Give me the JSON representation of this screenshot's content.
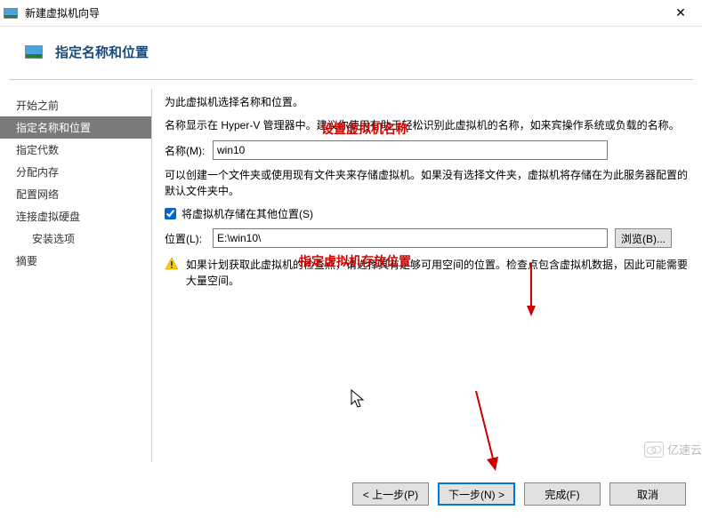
{
  "titlebar": {
    "title": "新建虚拟机向导",
    "close": "✕"
  },
  "header": {
    "title": "指定名称和位置"
  },
  "sidebar": {
    "items": [
      {
        "label": "开始之前"
      },
      {
        "label": "指定名称和位置"
      },
      {
        "label": "指定代数"
      },
      {
        "label": "分配内存"
      },
      {
        "label": "配置网络"
      },
      {
        "label": "连接虚拟硬盘"
      },
      {
        "label": "安装选项"
      },
      {
        "label": "摘要"
      }
    ]
  },
  "content": {
    "intro1": "为此虚拟机选择名称和位置。",
    "intro2": "名称显示在 Hyper-V 管理器中。建议你使用有助于轻松识别此虚拟机的名称，如来宾操作系统或负载的名称。",
    "name_label": "名称(M):",
    "name_value": "win10",
    "intro3": "可以创建一个文件夹或使用现有文件夹来存储虚拟机。如果没有选择文件夹，虚拟机将存储在为此服务器配置的默认文件夹中。",
    "checkbox_label": "将虚拟机存储在其他位置(S)",
    "checkbox_checked": true,
    "location_label": "位置(L):",
    "location_value": "E:\\win10\\",
    "browse_label": "浏览(B)...",
    "warning": "如果计划获取此虚拟机的检查点，请选择具有足够可用空间的位置。检查点包含虚拟机数据，因此可能需要大量空间。"
  },
  "annotations": {
    "a1": "设置虚拟机名称",
    "a2": "指定虚拟机存放位置"
  },
  "footer": {
    "prev": "< 上一步(P)",
    "next": "下一步(N) >",
    "finish": "完成(F)",
    "cancel": "取消"
  },
  "watermark": "亿速云"
}
